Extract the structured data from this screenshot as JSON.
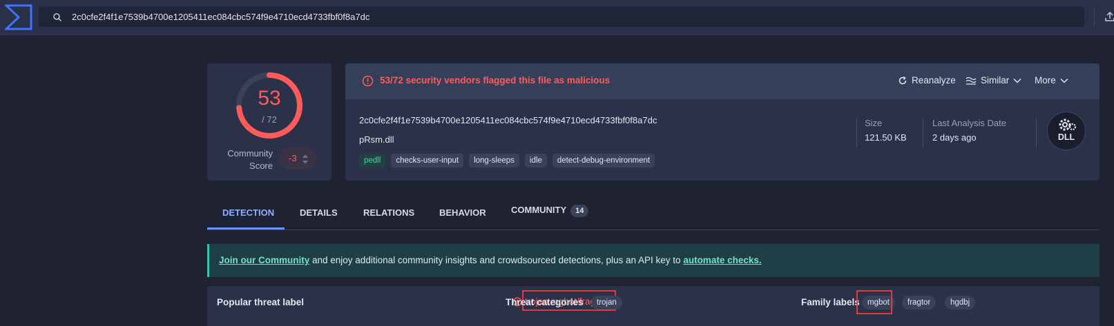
{
  "search": {
    "value": "2c0cfe2f4f1e7539b4700e1205411ec084cbc574f9e4710ecd4733fbf0f8a7dc"
  },
  "score": {
    "detections": "53",
    "total": "/ 72",
    "community_label": "Community Score",
    "community_value": "-3"
  },
  "file": {
    "alert": "53/72 security vendors flagged this file as malicious",
    "actions": {
      "reanalyze": "Reanalyze",
      "similar": "Similar",
      "more": "More"
    },
    "hash": "2c0cfe2f4f1e7539b4700e1205411ec084cbc574f9e4710ecd4733fbf0f8a7dc",
    "name": "pRsm.dll",
    "tags": [
      "pedll",
      "checks-user-input",
      "long-sleeps",
      "idle",
      "detect-debug-environment"
    ],
    "size_label": "Size",
    "size_value": "121.50 KB",
    "last_analysis_label": "Last Analysis Date",
    "last_analysis_value": "2 days ago",
    "type_badge": "DLL"
  },
  "tabs": {
    "detection": "DETECTION",
    "details": "DETAILS",
    "relations": "RELATIONS",
    "behavior": "BEHAVIOR",
    "community": "COMMUNITY",
    "community_count": "14"
  },
  "banner": {
    "join_link": "Join our Community",
    "middle": " and enjoy additional community insights and crowdsourced detections, plus an API key to ",
    "automate_link": "automate checks."
  },
  "threat": {
    "popular_label": "Popular threat label",
    "popular_value": "trojan.mgbot/fragtor",
    "categories_label": "Threat categories",
    "categories": [
      "trojan"
    ],
    "family_label": "Family labels",
    "families": [
      "mgbot",
      "fragtor",
      "hgdbj"
    ]
  },
  "colors": {
    "malicious": "#ff5b5b",
    "accent": "#6d8fff",
    "banner": "#1e3f45"
  },
  "icons": [
    "virustotal-logo-icon",
    "search-icon",
    "upload-icon",
    "alert-circle-icon",
    "refresh-icon",
    "similar-icon",
    "chevron-down-icon",
    "gear-icon"
  ]
}
